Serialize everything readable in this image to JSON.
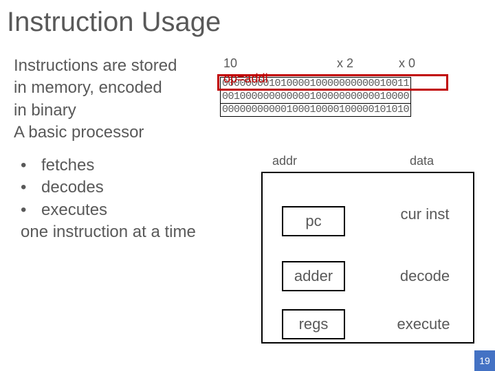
{
  "title": "Instruction Usage",
  "paragraph": {
    "l1": "Instructions are stored",
    "l2": "in memory, encoded",
    "l3": "in binary",
    "l4": "A basic processor"
  },
  "bullets": {
    "b1": "fetches",
    "b2": "decodes",
    "b3": "executes",
    "final": "one instruction at a time"
  },
  "annotations": {
    "imm": "10",
    "x2": "x 2",
    "x0": "x 0",
    "op": "op=addi"
  },
  "memory": {
    "r0": "00000000101000010000000000010011",
    "r1": "00100000000000010000000000010000",
    "r2": "00000000000100010000100000101010"
  },
  "cpu": {
    "addr": "addr",
    "data": "data",
    "pc": "pc",
    "curinst": "cur inst",
    "adder": "adder",
    "decode": "decode",
    "regs": "regs",
    "execute": "execute"
  },
  "page": "19"
}
